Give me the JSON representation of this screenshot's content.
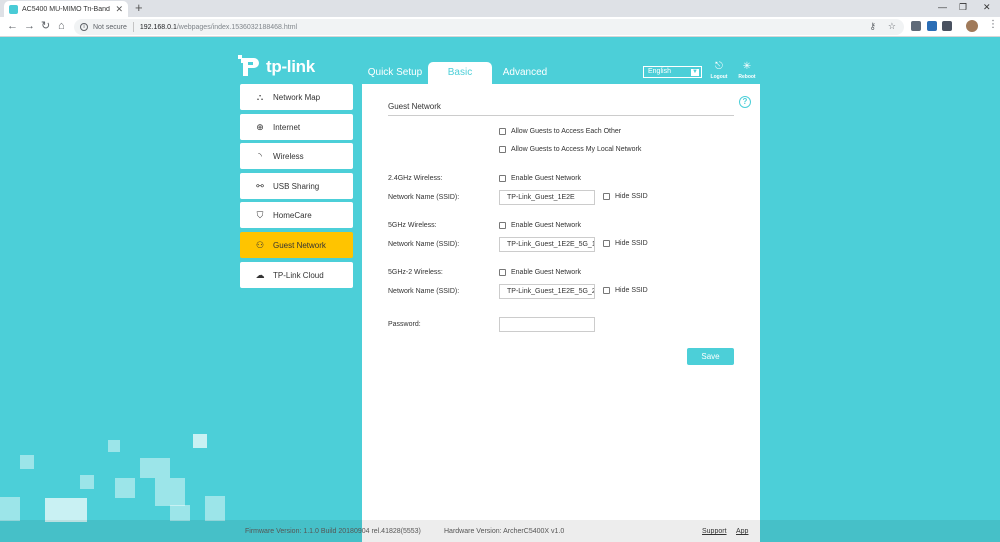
{
  "browser": {
    "tab_title": "AC5400 MU-MIMO Tri-Band Ga",
    "new_tab": "+",
    "not_secure": "Not secure",
    "url_host": "192.168.0.1",
    "url_path": "/webpages/index.1536032188468.html"
  },
  "brand": {
    "logo_text": "tp-link"
  },
  "nav": {
    "tabs": [
      "Quick Setup",
      "Basic",
      "Advanced"
    ],
    "active": "Basic",
    "language": "English",
    "logout": "Logout",
    "reboot": "Reboot"
  },
  "sidebar": {
    "items": [
      {
        "label": "Network Map",
        "icon": "network-map-icon"
      },
      {
        "label": "Internet",
        "icon": "globe-icon"
      },
      {
        "label": "Wireless",
        "icon": "wifi-icon"
      },
      {
        "label": "USB Sharing",
        "icon": "usb-icon"
      },
      {
        "label": "HomeCare",
        "icon": "shield-icon"
      },
      {
        "label": "Guest Network",
        "icon": "guest-icon"
      },
      {
        "label": "TP-Link Cloud",
        "icon": "cloud-icon"
      }
    ],
    "active": "Guest Network"
  },
  "panel": {
    "title": "Guest Network",
    "allow_each_other": "Allow Guests to Access Each Other",
    "allow_local": "Allow Guests to Access My Local Network",
    "band1_label": "2.4GHz Wireless:",
    "band2_label": "5GHz Wireless:",
    "band3_label": "5GHz-2 Wireless:",
    "enable_guest": "Enable Guest Network",
    "ssid_label": "Network Name (SSID):",
    "ssid1": "TP-Link_Guest_1E2E",
    "ssid2": "TP-Link_Guest_1E2E_5G_1",
    "ssid3": "TP-Link_Guest_1E2E_5G_2",
    "hide_ssid": "Hide SSID",
    "password_label": "Password:",
    "password_value": "",
    "save": "Save"
  },
  "footer": {
    "firmware": "Firmware Version: 1.1.0 Build 20180904 rel.41828(5553)",
    "hardware": "Hardware Version: ArcherC5400X v1.0",
    "support": "Support",
    "app": "App"
  },
  "colors": {
    "page_bg": "#4ccfd8",
    "active_sidebar": "#ffc400",
    "accent": "#4ccfd8"
  }
}
